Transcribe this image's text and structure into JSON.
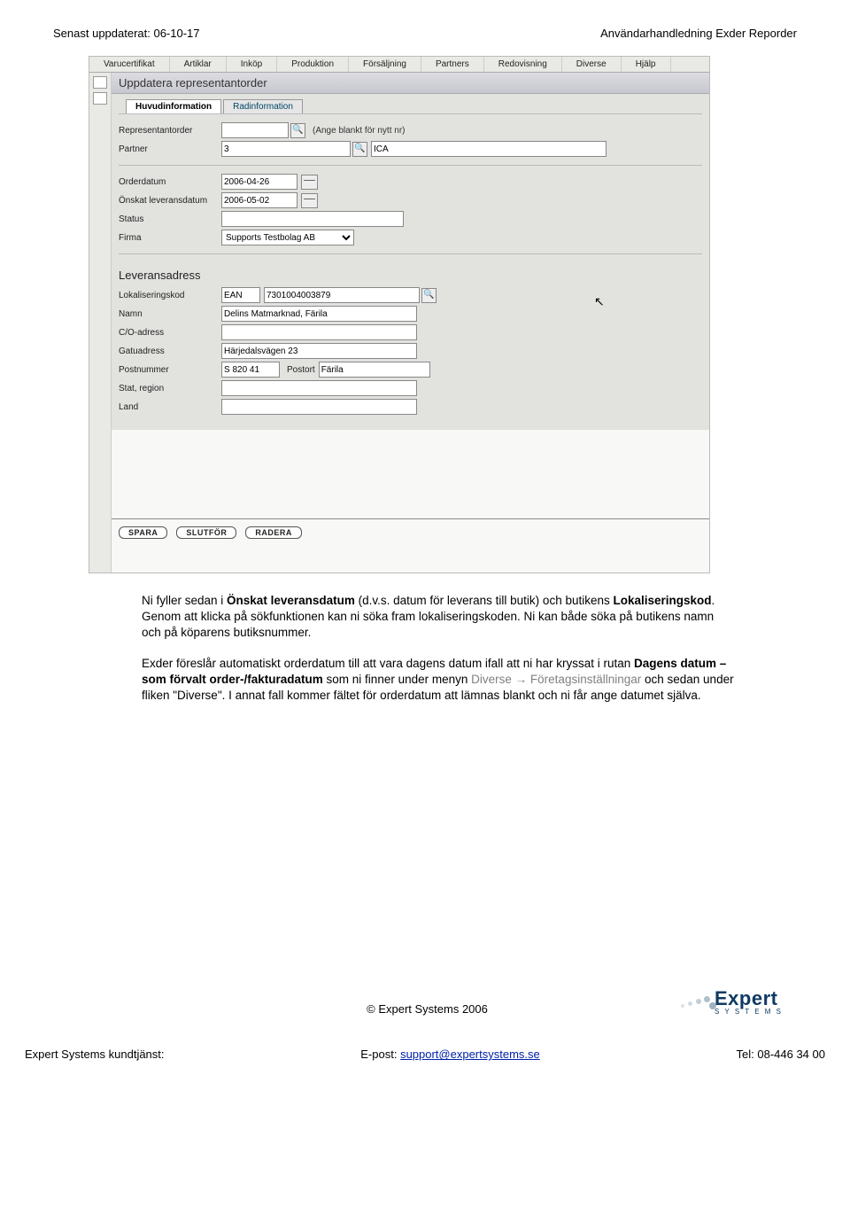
{
  "header": {
    "left": "Senast uppdaterat: 06-10-17",
    "right": "Användarhandledning Exder Reporder"
  },
  "menu": [
    "Varucertifikat",
    "Artiklar",
    "Inköp",
    "Produktion",
    "Försäljning",
    "Partners",
    "Redovisning",
    "Diverse",
    "Hjälp"
  ],
  "screen": {
    "title": "Uppdatera representantorder",
    "tabs": {
      "active": "Huvudinformation",
      "other": "Radinformation"
    },
    "rep_order_label": "Representantorder",
    "rep_order_hint": "(Ange blankt för nytt nr)",
    "partner_label": "Partner",
    "partner_value": "3",
    "partner_name": "ICA",
    "orderdatum_label": "Orderdatum",
    "orderdatum_value": "2006-04-26",
    "levdatum_label": "Önskat leveransdatum",
    "levdatum_value": "2006-05-02",
    "status_label": "Status",
    "firma_label": "Firma",
    "firma_value": "Supports Testbolag AB",
    "addr_title": "Leveransadress",
    "lokkod_label": "Lokaliseringskod",
    "lokkod_type": "EAN",
    "lokkod_value": "7301004003879",
    "namn_label": "Namn",
    "namn_value": "Delins Matmarknad, Färila",
    "co_label": "C/O-adress",
    "gatu_label": "Gatuadress",
    "gatu_value": "Härjedalsvägen 23",
    "postnr_label": "Postnummer",
    "postnr_value": "S 820 41",
    "postort_label": "Postort",
    "postort_value": "Färila",
    "stat_label": "Stat, region",
    "land_label": "Land",
    "btn_save": "SPARA",
    "btn_done": "SLUTFÖR",
    "btn_del": "RADERA"
  },
  "body": {
    "p1a": "Ni fyller sedan i ",
    "p1b": "Önskat leveransdatum",
    "p1c": " (d.v.s. datum för leverans till butik) och butikens ",
    "p1d": "Lokaliseringskod",
    "p1e": ". Genom att klicka på sökfunktionen kan ni söka fram lokaliseringskoden. Ni kan både söka på butikens namn och på köparens butiksnummer.",
    "p2a": "Exder föreslår automatiskt orderdatum till att vara dagens datum ifall att ni har kryssat i rutan ",
    "p2b": "Dagens datum – som förvalt order-/fakturadatum",
    "p2c": " som ni finner under menyn ",
    "p2d": "Diverse",
    "p2e": " → ",
    "p2f": "Företagsinställningar",
    "p2g": " och sedan under fliken \"Diverse\". I annat fall kommer fältet för orderdatum att lämnas blankt och ni får ange datumet själva."
  },
  "footer": {
    "copyright": "© Expert Systems 2006",
    "left": "Expert Systems kundtjänst:",
    "mid_label": "E-post: ",
    "mid_link": "support@expertsystems.se",
    "right": "Tel: 08-446 34 00",
    "logo_main": "Expert",
    "logo_sub": "S Y S T E M S"
  }
}
